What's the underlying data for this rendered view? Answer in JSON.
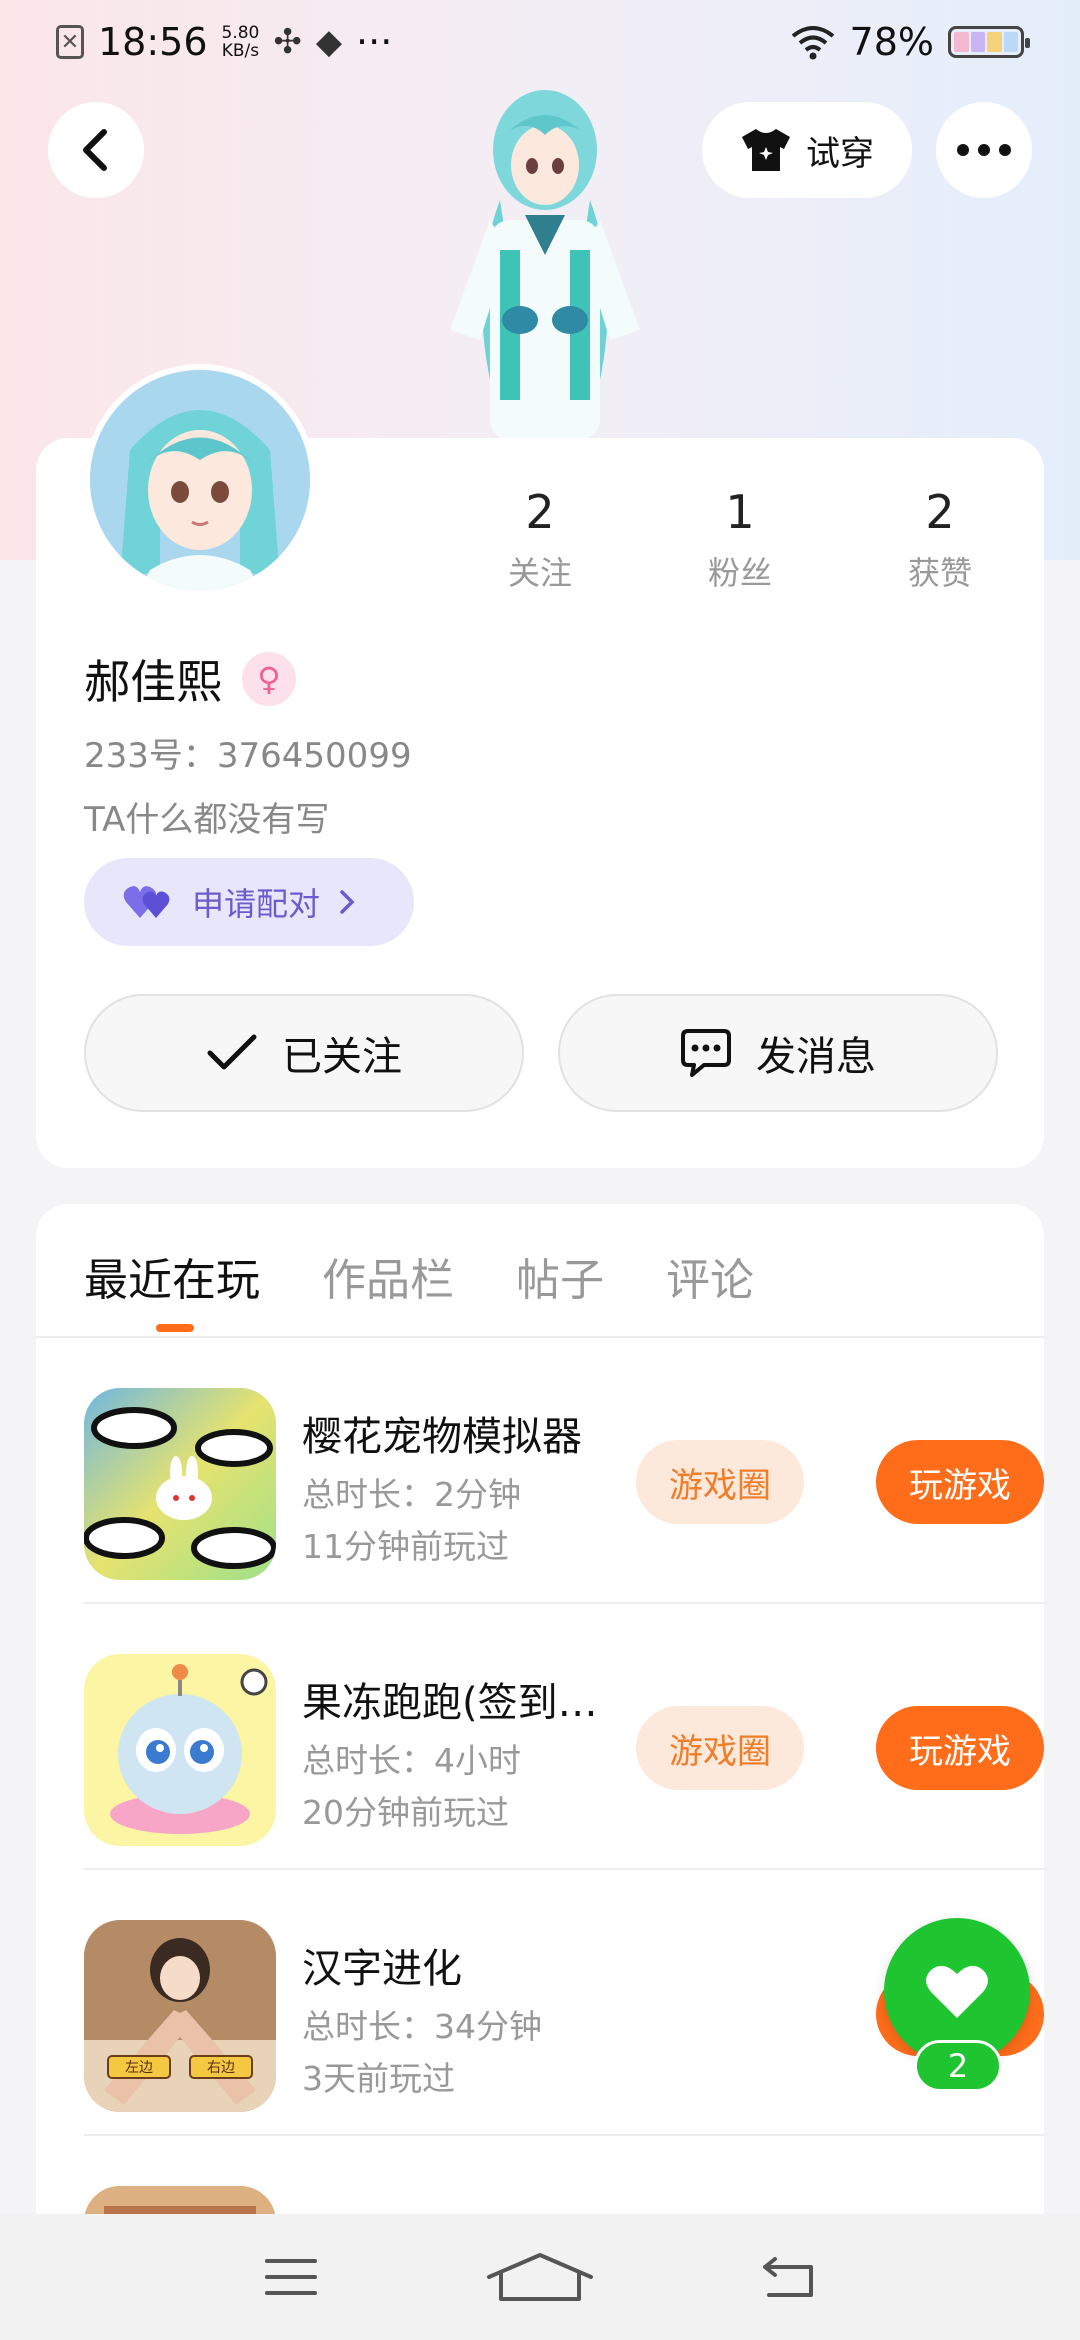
{
  "status_bar": {
    "time": "18:56",
    "net_speed_value": "5.80",
    "net_speed_unit": "KB/s",
    "more": "···",
    "battery": "78%"
  },
  "header": {
    "try_on_label": "试穿"
  },
  "profile": {
    "stats": [
      {
        "value": "2",
        "label": "关注"
      },
      {
        "value": "1",
        "label": "粉丝"
      },
      {
        "value": "2",
        "label": "获赞"
      }
    ],
    "name": "郝佳熙",
    "id_line": "233号：376450099",
    "bio": "TA什么都没有写",
    "pair_button": "申请配对",
    "follow_button": "已关注",
    "message_button": "发消息"
  },
  "tabs": [
    {
      "label": "最近在玩",
      "active": true
    },
    {
      "label": "作品栏",
      "active": false
    },
    {
      "label": "帖子",
      "active": false
    },
    {
      "label": "评论",
      "active": false
    }
  ],
  "games": [
    {
      "title": "樱花宠物模拟器",
      "duration": "总时长：2分钟",
      "last_played": "11分钟前玩过",
      "circle_label": "游戏圈",
      "play_label": "玩游戏"
    },
    {
      "title": "果冻跑跑(签到…",
      "duration": "总时长：4小时",
      "last_played": "20分钟前玩过",
      "circle_label": "游戏圈",
      "play_label": "玩游戏"
    },
    {
      "title": "汉字进化",
      "duration": "总时长：34分钟",
      "last_played": "3天前玩过",
      "icon_left_label": "左边",
      "icon_right_label": "右边",
      "play_label": "玩"
    }
  ],
  "favorite": {
    "count": "2"
  },
  "colors": {
    "accent_orange": "#ff6d1a",
    "favorite_green": "#1fc431",
    "pair_purple": "#6a5ccc"
  }
}
